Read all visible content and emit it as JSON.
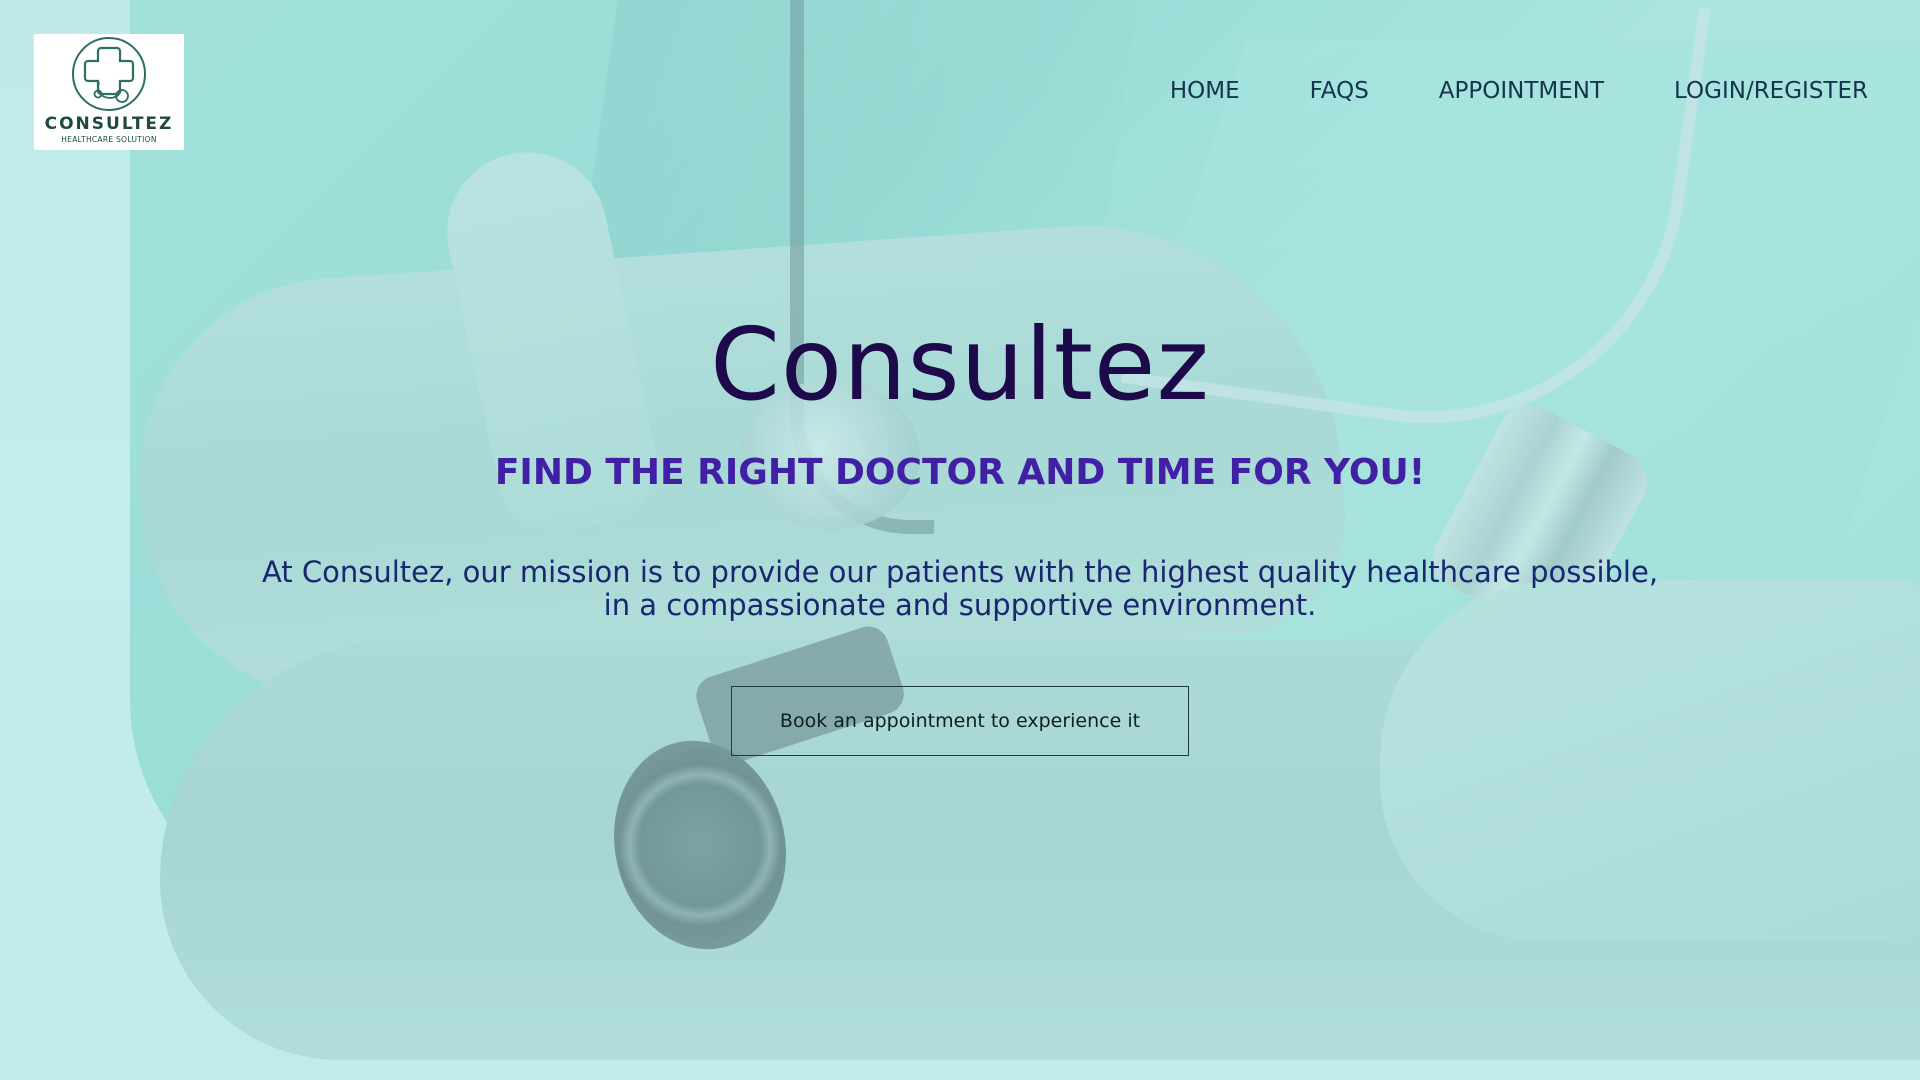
{
  "logo": {
    "name": "CONSULTEZ",
    "tagline": "HEALTHCARE SOLUTION",
    "icon": "medical-cross-stethoscope-icon"
  },
  "nav": {
    "items": [
      {
        "label": "HOME"
      },
      {
        "label": "FAQS"
      },
      {
        "label": "APPOINTMENT"
      },
      {
        "label": "LOGIN/REGISTER"
      }
    ]
  },
  "hero": {
    "title": "Consultez",
    "tagline": "FIND THE RIGHT DOCTOR AND TIME FOR YOU!",
    "mission_line1": "At Consultez, our mission is to provide our patients with the highest quality healthcare possible,",
    "mission_line2": "in a compassionate and supportive environment.",
    "cta_label": "Book an appointment to experience it"
  },
  "colors": {
    "title": "#1e0a4a",
    "tagline": "#4220a6",
    "mission": "#1a2670",
    "nav": "#16334f",
    "background_tint": "#bfe9e8",
    "scrubs": "#8fd9d0"
  }
}
